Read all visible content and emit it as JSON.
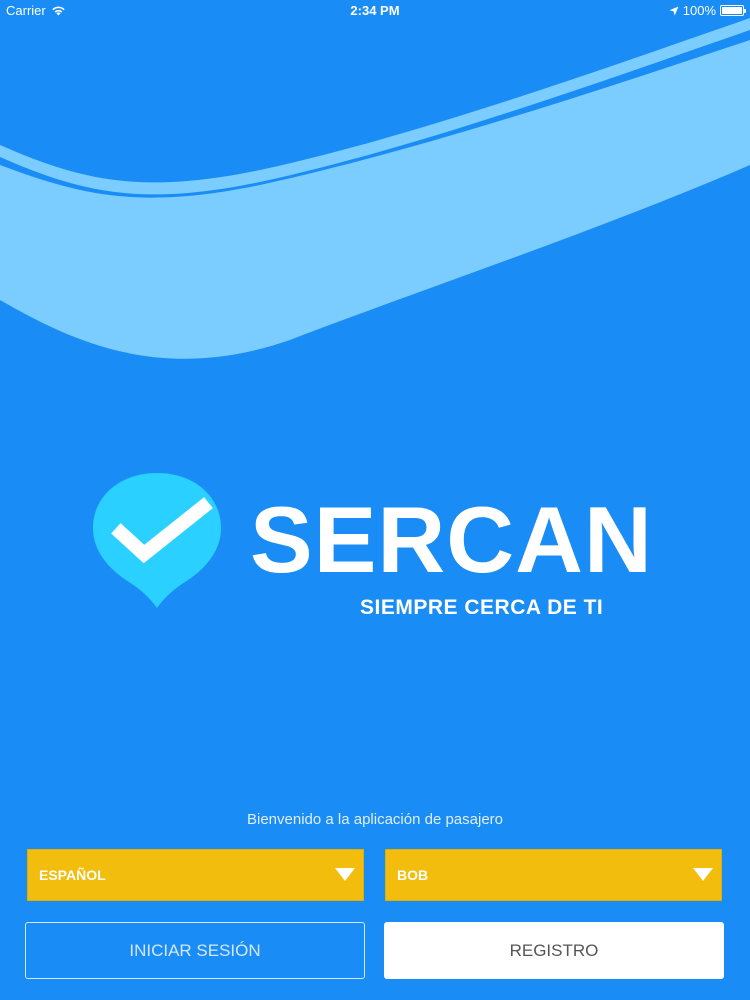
{
  "status_bar": {
    "carrier": "Carrier",
    "time": "2:34 PM",
    "battery": "100%",
    "battery_level": 1.0
  },
  "brand": {
    "name": "SERCAN",
    "tagline": "SIEMPRE CERCA DE TI",
    "pin_color": "#2ad0ff"
  },
  "welcome_text": "Bienvenido a la aplicación de pasajero",
  "language_select": {
    "value": "ESPAÑOL"
  },
  "currency_select": {
    "value": "BOB"
  },
  "buttons": {
    "login_label": "INICIAR SESIÓN",
    "register_label": "REGISTRO"
  },
  "colors": {
    "background": "#1a8cf5",
    "swoosh": "#7ccdff",
    "select": "#f2bd0c"
  }
}
